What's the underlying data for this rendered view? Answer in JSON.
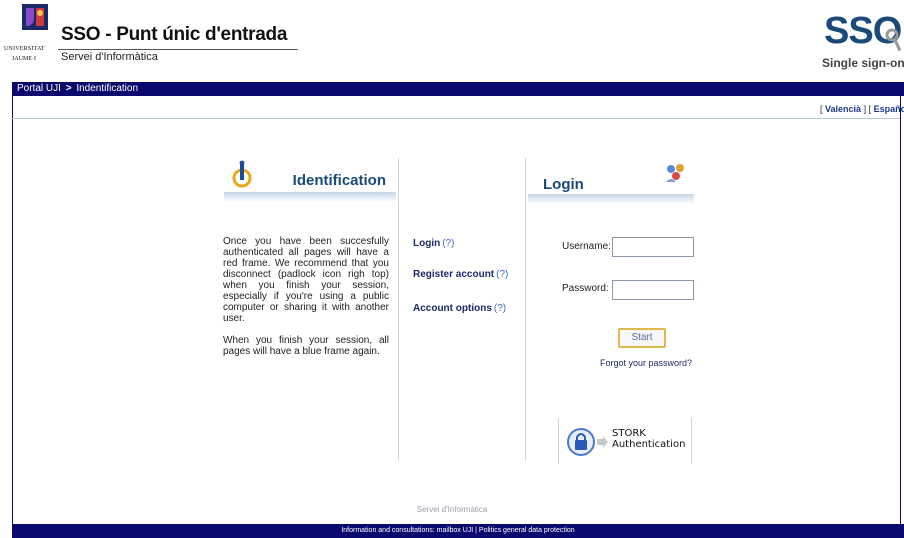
{
  "header": {
    "university_line1": "UNIVERSITAT",
    "university_line2": "JAUME·I",
    "title": "SSO - Punt únic d'entrada",
    "subtitle": "Servei d'Informàtica",
    "sso_logo_text": "SSO",
    "sso_logo_sub": "Single sign-on"
  },
  "breadcrumb": {
    "home": "Portal UJI",
    "separator": ">",
    "current": "Indentification"
  },
  "languages": {
    "valencia": "Valencià",
    "espanol": "Español"
  },
  "identification": {
    "title": "Identification",
    "paragraph1": "Once you have been succesfully authenticated all pages will have a red frame. We recommend that you disconnect (padlock icon righ top) when you finish your session, especially if you're using a public computer or sharing it with another user.",
    "paragraph2": "When you finish your session, all pages will have a blue frame again."
  },
  "links": {
    "login": "Login",
    "register": "Register account",
    "account_options": "Account options",
    "help": "(?)"
  },
  "login": {
    "title": "Login",
    "username_label": "Username:",
    "password_label": "Password:",
    "username_value": "",
    "password_value": "",
    "start_button": "Start",
    "forgot": "Forgot your password?"
  },
  "stork": {
    "line1": "STORK",
    "line2": "Authentication"
  },
  "footer": {
    "credit": "Servei d'Informàtica",
    "info": "Information and consultations: mailbox UJI | Politics general data protection"
  },
  "colors": {
    "nav_bar": "#0a0a6e",
    "heading_blue": "#1a4a78",
    "link_blue": "#1a2a66"
  }
}
